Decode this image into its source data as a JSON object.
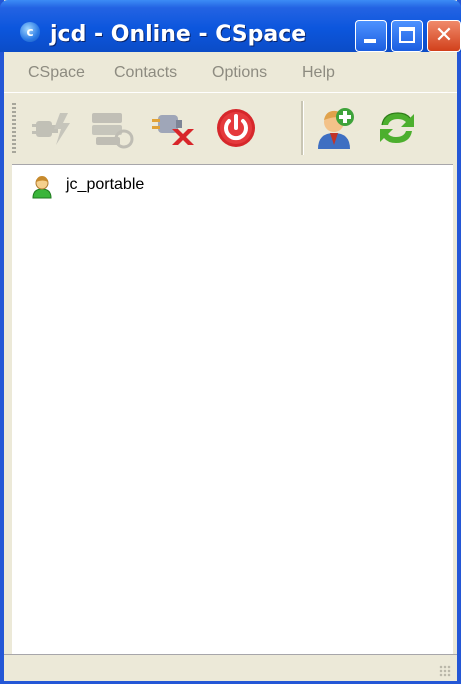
{
  "window": {
    "title": "jcd - Online - CSpace",
    "app_icon_letter": "c",
    "controls": {
      "minimize": "",
      "maximize": "",
      "close": "✕"
    }
  },
  "menubar": {
    "items": [
      "CSpace",
      "Contacts",
      "Options",
      "Help"
    ]
  },
  "toolbar": {
    "buttons": [
      {
        "icon": "connect-plug-icon",
        "enabled": false
      },
      {
        "icon": "network-servers-icon",
        "enabled": false
      },
      {
        "icon": "disconnect-icon",
        "enabled": true
      },
      {
        "icon": "power-off-icon",
        "enabled": true
      },
      {
        "icon": "add-contact-icon",
        "enabled": true
      },
      {
        "icon": "refresh-icon",
        "enabled": true
      }
    ]
  },
  "contacts": [
    {
      "name": "jc_portable",
      "status_icon": "online-user-icon",
      "status_color": "#3ab53a"
    }
  ],
  "colors": {
    "titlebar": "#0c56dd",
    "window_frame": "#2457d6",
    "chrome": "#ece9d8",
    "close_button": "#d2401b"
  }
}
